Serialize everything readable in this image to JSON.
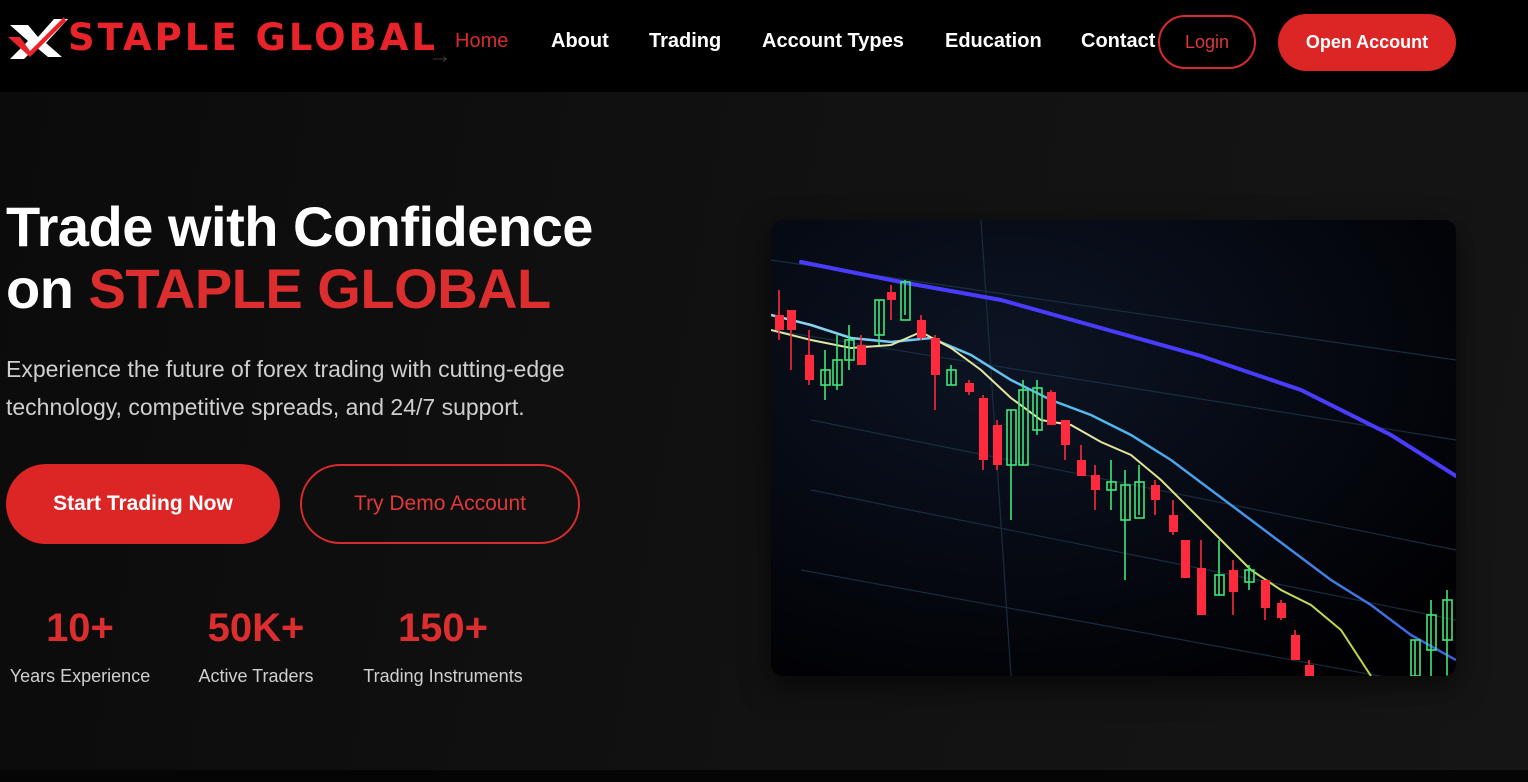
{
  "brand": {
    "name": "STAPLE GLOBAL",
    "color": "#dc2626"
  },
  "nav": {
    "items": [
      {
        "label": "Home",
        "active": true
      },
      {
        "label": "About",
        "active": false
      },
      {
        "label": "Trading",
        "active": false
      },
      {
        "label": "Account Types",
        "active": false
      },
      {
        "label": "Education",
        "active": false
      },
      {
        "label": "Contact",
        "active": false
      }
    ],
    "arrow_icon": "arrow-right-icon",
    "login_label": "Login",
    "open_account_label": "Open Account"
  },
  "hero": {
    "title_line1": "Trade with Confidence",
    "title_line2_prefix": "on ",
    "title_line2_accent": "STAPLE GLOBAL",
    "subtitle": "Experience the future of forex trading with cutting-edge technology, competitive spreads, and 24/7 support.",
    "primary_cta": "Start Trading Now",
    "secondary_cta": "Try Demo Account",
    "stats": [
      {
        "value": "10+",
        "label": "Years Experience"
      },
      {
        "value": "50K+",
        "label": "Active Traders"
      },
      {
        "value": "150+",
        "label": "Trading Instruments"
      }
    ]
  },
  "chart_data": {
    "type": "candlestick-image",
    "title": "",
    "colors": {
      "up": "#3ee67a",
      "down": "#ff2a3d",
      "ma_slow": "#4a3cff",
      "ma_mid": "#5fc8f0",
      "ma_fast": "#f0e6a0"
    }
  }
}
